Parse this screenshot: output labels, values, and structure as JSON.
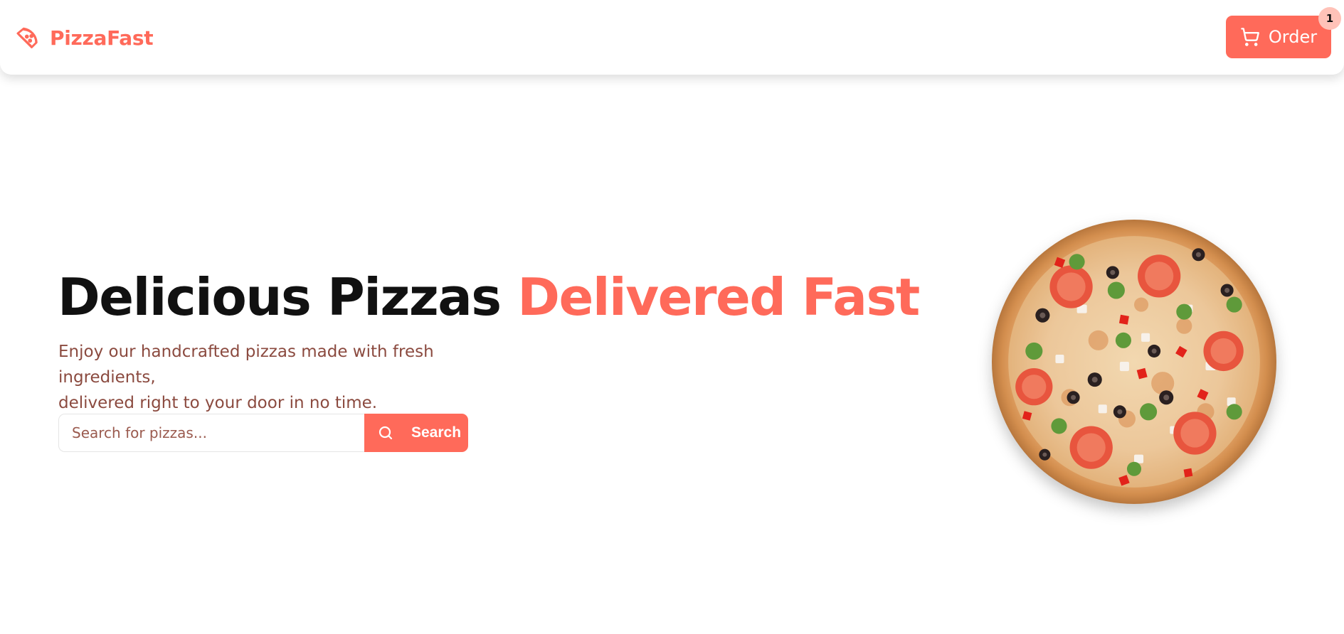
{
  "navbar": {
    "brand_name": "PizzaFast",
    "brand_icon": "pizza-slice-icon",
    "order_label": "Order",
    "order_icon": "shopping-cart-icon",
    "cart_count": "1"
  },
  "hero": {
    "title_main": "Delicious Pizzas",
    "title_accent": "Delivered Fast",
    "subtitle_line1": "Enjoy our handcrafted pizzas made with fresh ingredients,",
    "subtitle_line2": "delivered right to your door in no time.",
    "search": {
      "placeholder": "Search for pizzas...",
      "value": "",
      "button_label": "Search",
      "button_icon": "search-icon"
    },
    "image": "vegetable-pizza-image"
  },
  "colors": {
    "accent": "#ff6a5a",
    "subtitle": "#8b4a3f",
    "badge": "#ffc2b8",
    "title": "#111111"
  }
}
